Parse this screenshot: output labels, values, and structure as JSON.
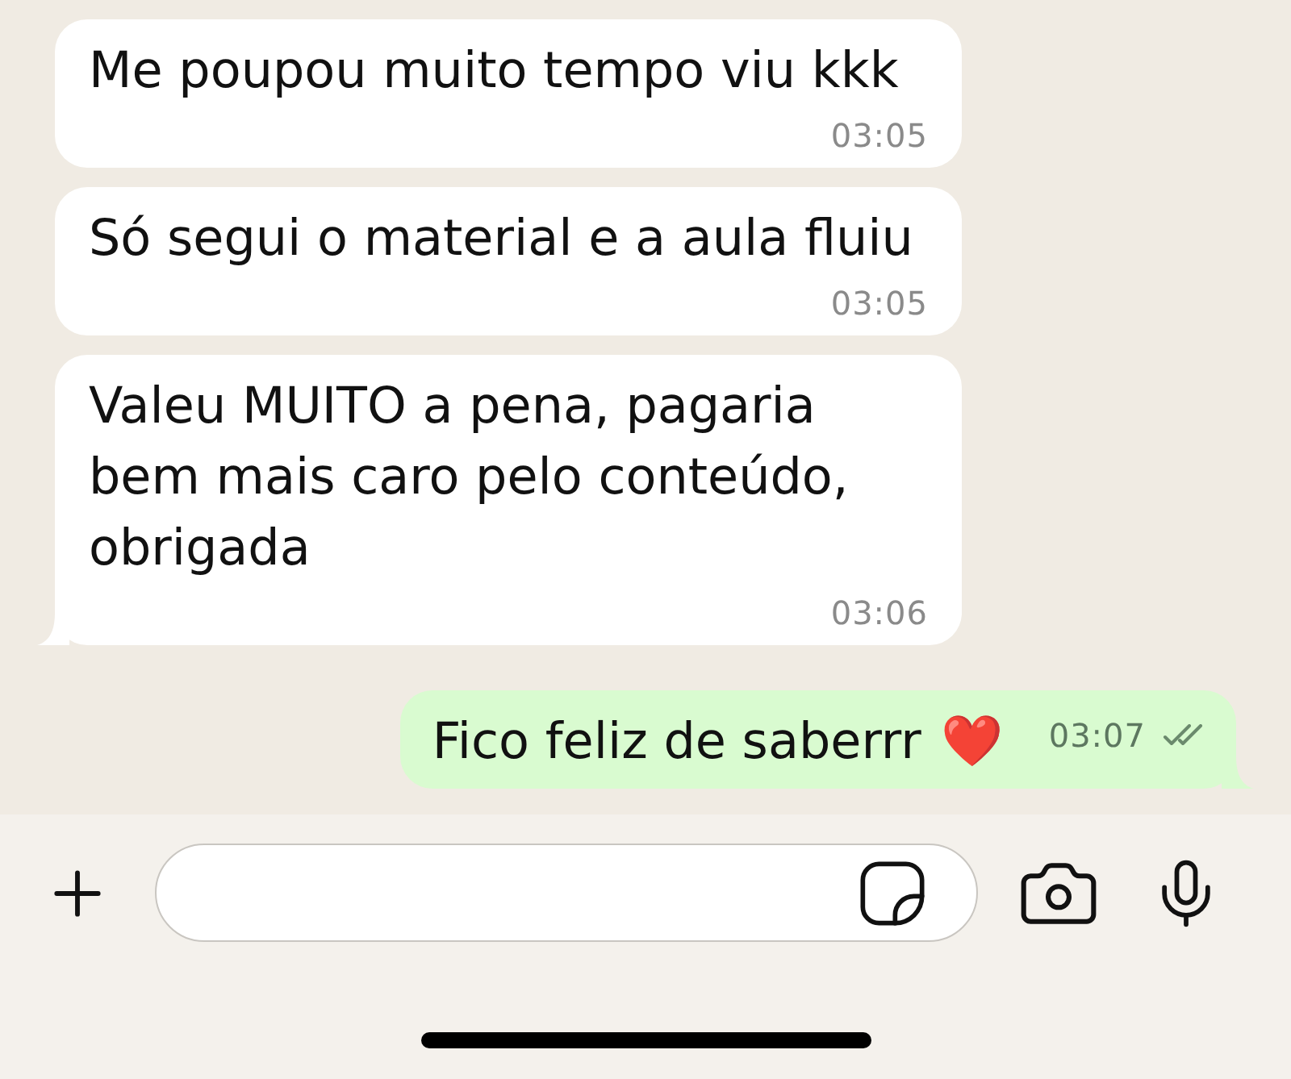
{
  "messages": [
    {
      "kind": "incoming",
      "text": "Me poupou muito tempo viu kkk",
      "time": "03:05",
      "tail": false
    },
    {
      "kind": "incoming",
      "text": "Só segui o material e a aula fluiu",
      "time": "03:05",
      "tail": false
    },
    {
      "kind": "incoming",
      "text": "Valeu MUITO a pena, pagaria bem mais caro pelo conteúdo, obrigada",
      "time": "03:06",
      "tail": true
    },
    {
      "kind": "outgoing",
      "text": "Fico feliz de saberrr",
      "emoji": "❤️",
      "time": "03:07",
      "delivered": true,
      "read": false,
      "tail": true
    }
  ]
}
